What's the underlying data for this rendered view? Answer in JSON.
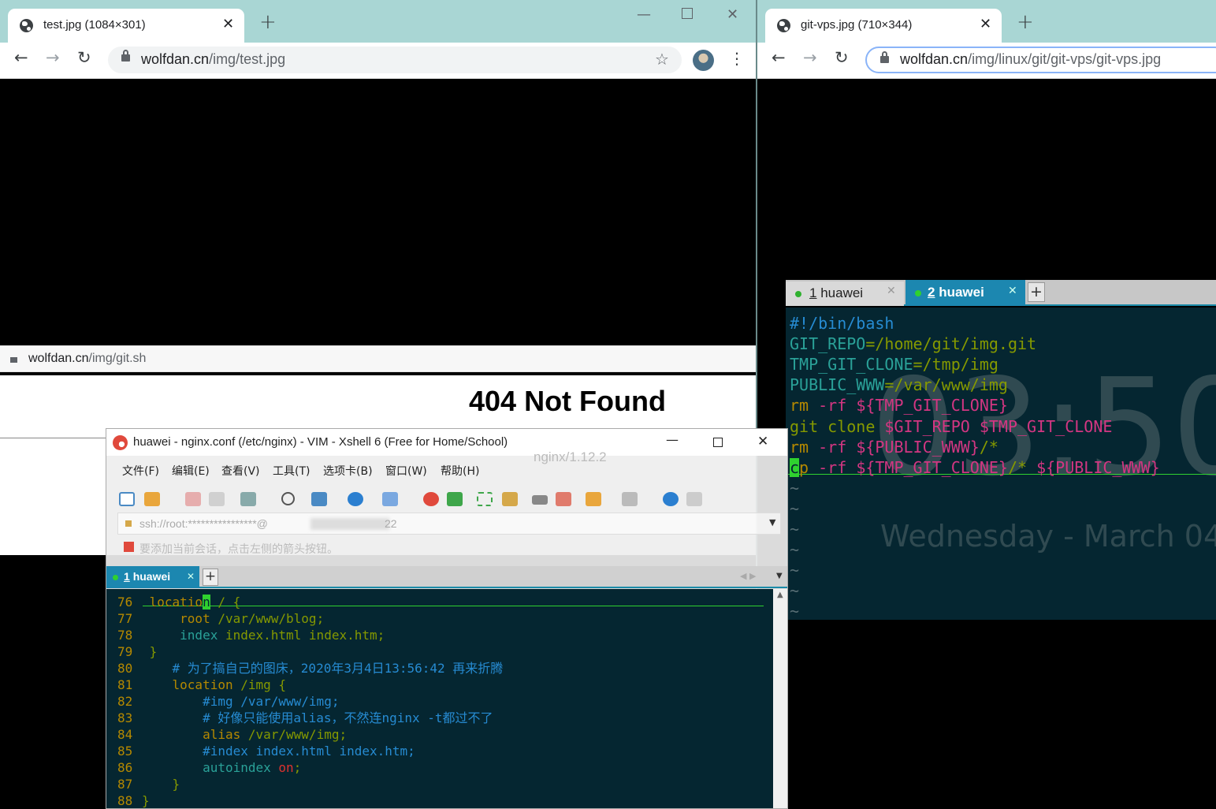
{
  "left_browser": {
    "tab_title": "test.jpg (1084×301)",
    "url_host": "wolfdan.cn",
    "url_path": "/img/test.jpg",
    "status_url_host": "wolfdan.cn",
    "status_url_path": "/img/git.sh",
    "not_found": "404 Not Found",
    "server": "nginx/1.12.2"
  },
  "right_browser": {
    "tab_title": "git-vps.jpg (710×344)",
    "url_host": "wolfdan.cn",
    "url_path": "/img/linux/git/git-vps/git-vps.jpg"
  },
  "right_terminal": {
    "tabs": [
      {
        "num": "1",
        "name": "huawei"
      },
      {
        "num": "2",
        "name": "huawei"
      }
    ],
    "clock": "03:50",
    "date": "Wednesday - March 04",
    "lines": [
      [
        {
          "t": "#!/bin/bash",
          "c": "#268bd2"
        }
      ],
      [
        {
          "t": "GIT_REPO",
          "c": "#2aa198"
        },
        {
          "t": "=/home/git/img.git",
          "c": "#859900"
        }
      ],
      [
        {
          "t": "TMP_GIT_CLONE",
          "c": "#2aa198"
        },
        {
          "t": "=/tmp/img",
          "c": "#859900"
        }
      ],
      [
        {
          "t": "PUBLIC_WWW",
          "c": "#2aa198"
        },
        {
          "t": "=/var/www/img",
          "c": "#859900"
        }
      ],
      [
        {
          "t": "rm",
          "c": "#b58900"
        },
        {
          "t": " -rf ",
          "c": "#d33682"
        },
        {
          "t": "${TMP_GIT_CLONE}",
          "c": "#d33682"
        }
      ],
      [
        {
          "t": "git clone ",
          "c": "#859900"
        },
        {
          "t": "$GIT_REPO $TMP_GIT_CLONE",
          "c": "#d33682"
        }
      ],
      [
        {
          "t": "rm",
          "c": "#b58900"
        },
        {
          "t": " -rf ",
          "c": "#d33682"
        },
        {
          "t": "${PUBLIC_WWW}",
          "c": "#d33682"
        },
        {
          "t": "/*",
          "c": "#859900"
        }
      ],
      [
        {
          "t": "c",
          "c": "#052631",
          "bg": "#2fd12f"
        },
        {
          "t": "p",
          "c": "#b58900"
        },
        {
          "t": " -rf ",
          "c": "#d33682"
        },
        {
          "t": "${TMP_GIT_CLONE}",
          "c": "#d33682"
        },
        {
          "t": "/* ",
          "c": "#859900"
        },
        {
          "t": "${PUBLIC_WWW}",
          "c": "#d33682"
        }
      ],
      [
        {
          "t": "~",
          "c": "#586e75"
        }
      ],
      [
        {
          "t": "~",
          "c": "#586e75"
        }
      ],
      [
        {
          "t": "~",
          "c": "#586e75"
        }
      ],
      [
        {
          "t": "~",
          "c": "#586e75"
        }
      ],
      [
        {
          "t": "~",
          "c": "#586e75"
        }
      ],
      [
        {
          "t": "~",
          "c": "#586e75"
        }
      ],
      [
        {
          "t": "~",
          "c": "#586e75"
        }
      ]
    ]
  },
  "xshell": {
    "title": "huawei - nginx.conf (/etc/nginx) - VIM - Xshell 6 (Free for Home/School)",
    "menu": [
      "文件(F)",
      "编辑(E)",
      "查看(V)",
      "工具(T)",
      "选项卡(B)",
      "窗口(W)",
      "帮助(H)"
    ],
    "address": "ssh://root:****************@",
    "address_tail": "22",
    "hint": "要添加当前会话，点击左侧的箭头按钮。",
    "tab": {
      "num": "1",
      "name": "huawei"
    },
    "lines": [
      {
        "n": "76",
        "segs": [
          {
            "t": " location",
            "c": "#b58900"
          },
          {
            "t": " / {",
            "c": "#859900"
          }
        ],
        "cursor": true
      },
      {
        "n": "77",
        "segs": [
          {
            "t": "     root",
            "c": "#b58900"
          },
          {
            "t": " /var/www/blog;",
            "c": "#859900"
          }
        ]
      },
      {
        "n": "78",
        "segs": [
          {
            "t": "     index",
            "c": "#2aa198"
          },
          {
            "t": " index.html index.htm;",
            "c": "#859900"
          }
        ]
      },
      {
        "n": "79",
        "segs": [
          {
            "t": " }",
            "c": "#859900"
          }
        ]
      },
      {
        "n": "80",
        "segs": [
          {
            "t": "    # 为了搞自己的图床，2020年3月4日13:56:42 再来折腾",
            "c": "#268bd2"
          }
        ]
      },
      {
        "n": "81",
        "segs": [
          {
            "t": "    location",
            "c": "#b58900"
          },
          {
            "t": " /img {",
            "c": "#859900"
          }
        ]
      },
      {
        "n": "82",
        "segs": [
          {
            "t": "        #img /var/www/img;",
            "c": "#268bd2"
          }
        ]
      },
      {
        "n": "83",
        "segs": [
          {
            "t": "        # 好像只能使用alias，不然连nginx -t都过不了",
            "c": "#268bd2"
          }
        ]
      },
      {
        "n": "84",
        "segs": [
          {
            "t": "        alias",
            "c": "#b58900"
          },
          {
            "t": " /var/www/img;",
            "c": "#859900"
          }
        ]
      },
      {
        "n": "85",
        "segs": [
          {
            "t": "        #index index.html index.htm;",
            "c": "#268bd2"
          }
        ]
      },
      {
        "n": "86",
        "segs": [
          {
            "t": "        autoindex",
            "c": "#2aa198"
          },
          {
            "t": " on",
            "c": "#dc322f"
          },
          {
            "t": ";",
            "c": "#859900"
          }
        ]
      },
      {
        "n": "87",
        "segs": [
          {
            "t": "    }",
            "c": "#859900"
          }
        ]
      },
      {
        "n": "88",
        "segs": [
          {
            "t": "}",
            "c": "#859900"
          }
        ]
      }
    ]
  }
}
